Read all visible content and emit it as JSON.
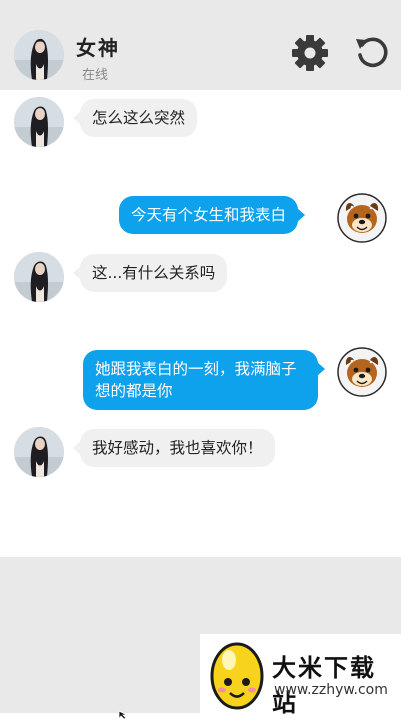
{
  "header": {
    "name": "女神",
    "status": "在线",
    "settings_icon": "gear-icon",
    "reload_icon": "reload-icon"
  },
  "messages": [
    {
      "side": "left",
      "text": "怎么这么突然"
    },
    {
      "side": "right",
      "text": "今天有个女生和我表白"
    },
    {
      "side": "left",
      "text": "这...有什么关系吗"
    },
    {
      "side": "right",
      "text": "她跟我表白的一刻，我满脑子想的都是你"
    },
    {
      "side": "left",
      "text": "我好感动，我也喜欢你！"
    }
  ],
  "watermark": {
    "title": "大米下载站",
    "url": "www.zzhyw.com"
  },
  "colors": {
    "header_bg": "#e9e9e9",
    "bubble_out": "#0ea1ec",
    "bubble_in": "#f0f0f0"
  }
}
